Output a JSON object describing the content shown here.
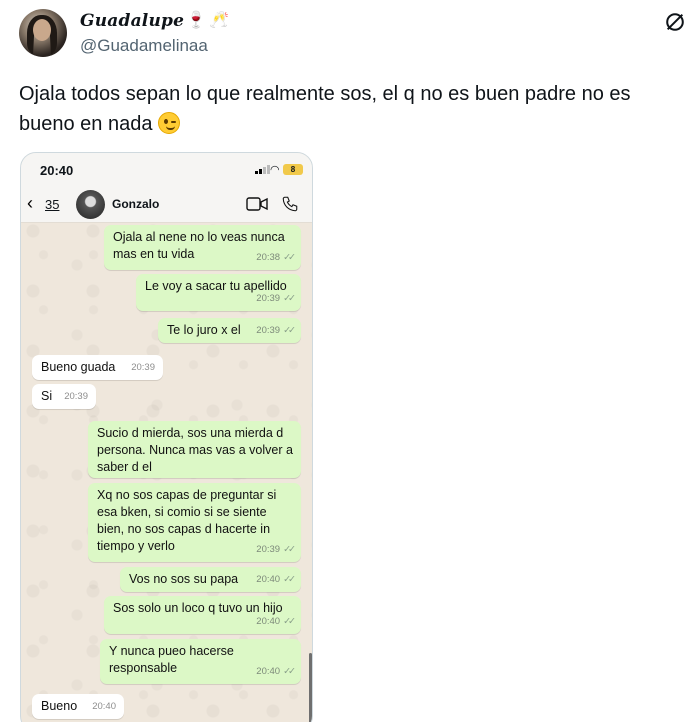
{
  "tweet": {
    "display_name": "Guadalupe",
    "name_emoji_1": "🍷",
    "name_emoji_2": "🥂",
    "handle": "@Guadamelinaa",
    "text": "Ojala todos sepan lo que realmente sos, el q no es buen padre no es bueno en nada",
    "text_emoji": "winking-face"
  },
  "phone": {
    "time": "20:40",
    "battery": "8",
    "unread_count": "35",
    "contact": "Gonzalo",
    "messages": [
      {
        "dir": "out",
        "text": "Ojala al nene no lo veas nunca mas en tu vida",
        "time": "20:38"
      },
      {
        "dir": "out",
        "text": "Le voy a sacar tu apellido",
        "time": "20:39"
      },
      {
        "dir": "out",
        "text": "Te lo juro x el",
        "time": "20:39"
      },
      {
        "dir": "in",
        "text": "Bueno guada",
        "time": "20:39"
      },
      {
        "dir": "in",
        "text": "Si",
        "time": "20:39"
      },
      {
        "dir": "out",
        "text": "Sucio d mierda, sos una mierda d persona. Nunca mas vas a volver a saber d el",
        "time": ""
      },
      {
        "dir": "out",
        "text": "Xq no sos capas de preguntar si esa bken, si comio si se siente bien, no sos capas d hacerte in tiempo y verlo",
        "time": "20:39"
      },
      {
        "dir": "out",
        "text": "Vos no sos su papa",
        "time": "20:40"
      },
      {
        "dir": "out",
        "text": "Sos solo un loco q tuvo un hijo",
        "time": "20:40"
      },
      {
        "dir": "out",
        "text": "Y nunca pueo hacerse responsable",
        "time": "20:40"
      },
      {
        "dir": "in",
        "text": "Bueno",
        "time": "20:40"
      }
    ]
  }
}
